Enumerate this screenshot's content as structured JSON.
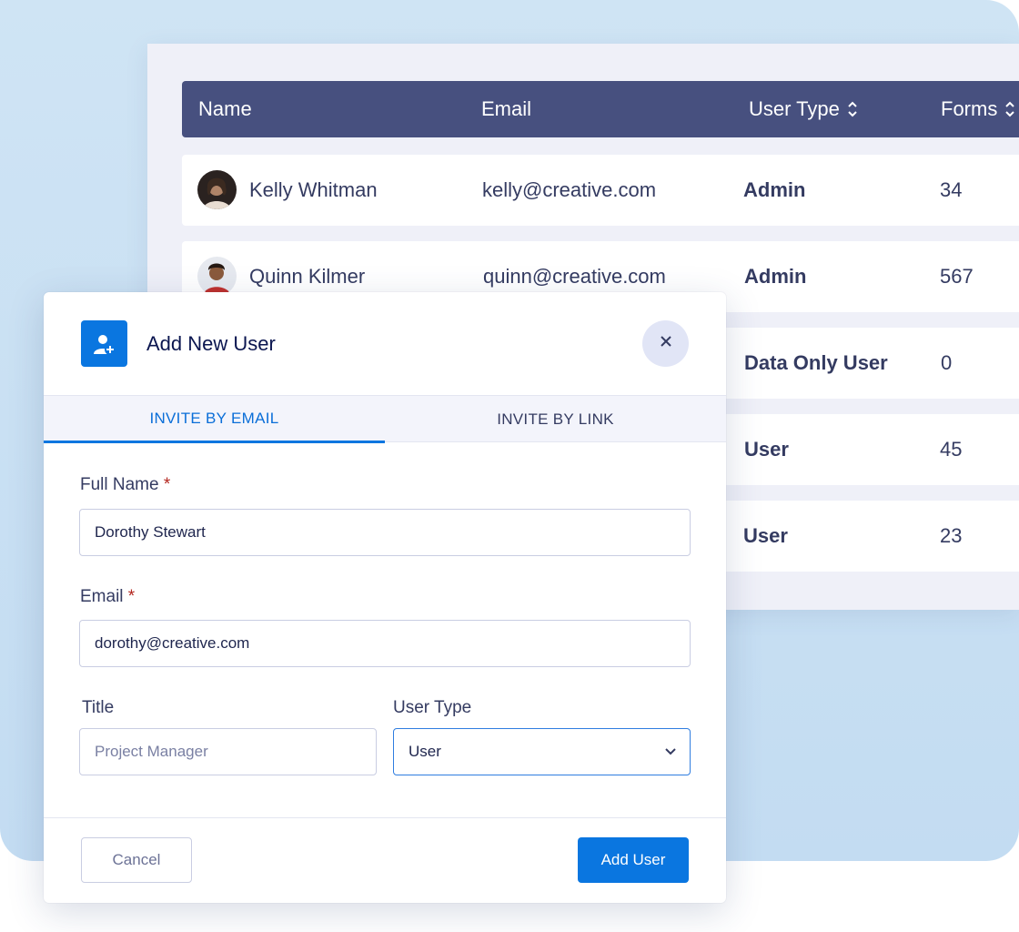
{
  "colors": {
    "header_bg": "#47507f",
    "accent": "#0a76e0",
    "background": "#c7dff3",
    "required_mark": "#b3261e"
  },
  "table": {
    "columns": [
      {
        "label": "Name",
        "sortable": false
      },
      {
        "label": "Email",
        "sortable": false
      },
      {
        "label": "User Type",
        "sortable": true
      },
      {
        "label": "Forms",
        "sortable": true
      }
    ],
    "rows": [
      {
        "name": "Kelly Whitman",
        "email": "kelly@creative.com",
        "user_type": "Admin",
        "forms": "34"
      },
      {
        "name": "Quinn Kilmer",
        "email": "quinn@creative.com",
        "user_type": "Admin",
        "forms": "567"
      },
      {
        "name": "",
        "email": "",
        "user_type": "Data Only User",
        "forms": "0"
      },
      {
        "name": "",
        "email": "",
        "user_type": "User",
        "forms": "45"
      },
      {
        "name": "",
        "email": "",
        "user_type": "User",
        "forms": "23"
      }
    ]
  },
  "modal": {
    "title": "Add New User",
    "icon": "add-user-icon",
    "tabs": [
      {
        "label": "INVITE BY EMAIL",
        "active": true
      },
      {
        "label": "INVITE BY LINK",
        "active": false
      }
    ],
    "fields": {
      "full_name": {
        "label": "Full Name",
        "required_mark": "*",
        "value": "Dorothy Stewart"
      },
      "email": {
        "label": "Email",
        "required_mark": "*",
        "value": "dorothy@creative.com"
      },
      "title": {
        "label": "Title",
        "value": "",
        "placeholder": "Project Manager"
      },
      "user_type": {
        "label": "User Type",
        "value": "User"
      }
    },
    "cancel_label": "Cancel",
    "submit_label": "Add User"
  }
}
